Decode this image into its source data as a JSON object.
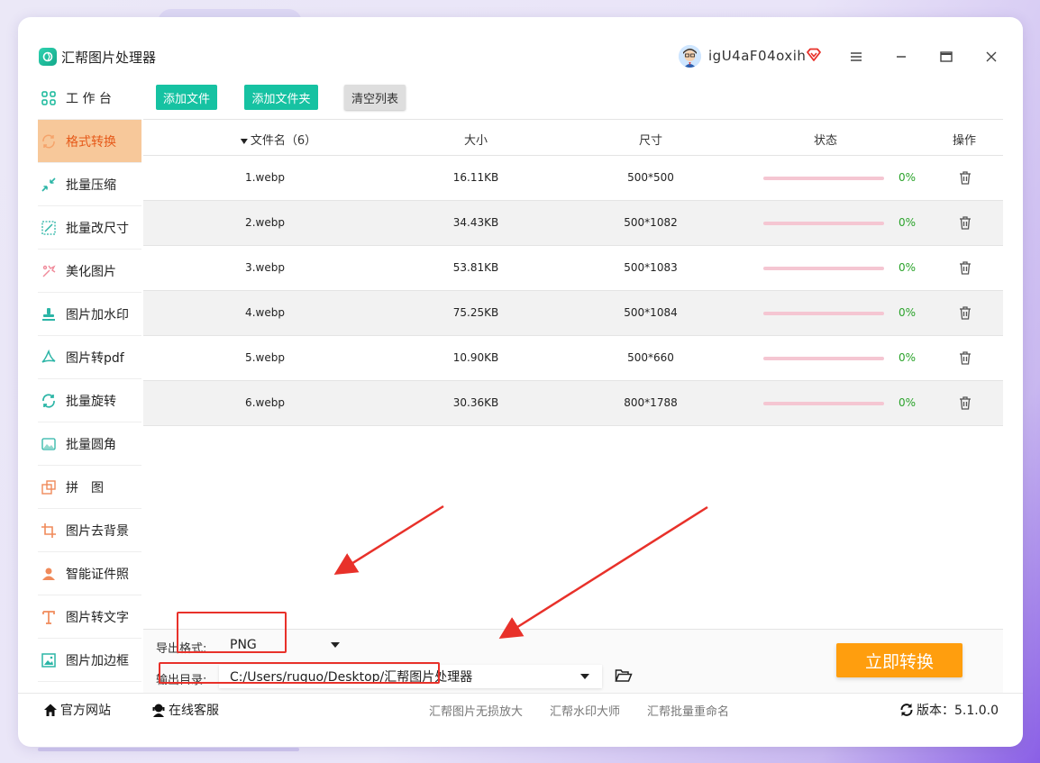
{
  "app": {
    "title": "汇帮图片处理器",
    "username": "igU4aF04oxih"
  },
  "sidebar": {
    "items": [
      {
        "label": "工 作 台",
        "icon": "grid-icon",
        "active": false
      },
      {
        "label": "格式转换",
        "icon": "convert-icon",
        "active": true
      },
      {
        "label": "批量压缩",
        "icon": "compress-icon",
        "active": false
      },
      {
        "label": "批量改尺寸",
        "icon": "resize-icon",
        "active": false
      },
      {
        "label": "美化图片",
        "icon": "beautify-icon",
        "active": false
      },
      {
        "label": "图片加水印",
        "icon": "watermark-icon",
        "active": false
      },
      {
        "label": "图片转pdf",
        "icon": "pdf-icon",
        "active": false
      },
      {
        "label": "批量旋转",
        "icon": "rotate-icon",
        "active": false
      },
      {
        "label": "批量圆角",
        "icon": "round-corner-icon",
        "active": false
      },
      {
        "label": "拼　图",
        "icon": "collage-icon",
        "active": false
      },
      {
        "label": "图片去背景",
        "icon": "crop-icon",
        "active": false
      },
      {
        "label": "智能证件照",
        "icon": "person-icon",
        "active": false
      },
      {
        "label": "图片转文字",
        "icon": "text-icon",
        "active": false
      },
      {
        "label": "图片加边框",
        "icon": "frame-icon",
        "active": false
      }
    ]
  },
  "toolbar": {
    "add_file": "添加文件",
    "add_folder": "添加文件夹",
    "clear_list": "清空列表"
  },
  "table": {
    "headers": {
      "name": "文件名（6）",
      "size": "大小",
      "dimensions": "尺寸",
      "status": "状态",
      "action": "操作"
    },
    "rows": [
      {
        "name": "1.webp",
        "size": "16.11KB",
        "dimensions": "500*500",
        "progress": "0%"
      },
      {
        "name": "2.webp",
        "size": "34.43KB",
        "dimensions": "500*1082",
        "progress": "0%"
      },
      {
        "name": "3.webp",
        "size": "53.81KB",
        "dimensions": "500*1083",
        "progress": "0%"
      },
      {
        "name": "4.webp",
        "size": "75.25KB",
        "dimensions": "500*1084",
        "progress": "0%"
      },
      {
        "name": "5.webp",
        "size": "10.90KB",
        "dimensions": "500*660",
        "progress": "0%"
      },
      {
        "name": "6.webp",
        "size": "30.36KB",
        "dimensions": "800*1788",
        "progress": "0%"
      }
    ]
  },
  "output": {
    "format_label": "导出格式:",
    "format_value": "PNG",
    "dir_label": "输出目录:",
    "dir_value": "C:/Users/ruguo/Desktop/汇帮图片处理器",
    "convert_button": "立即转换"
  },
  "footer": {
    "website": "官方网站",
    "support": "在线客服",
    "links": [
      "汇帮图片无损放大",
      "汇帮水印大师",
      "汇帮批量重命名"
    ],
    "version": "版本：5.1.0.0"
  },
  "colors": {
    "accent_teal": "#16c2a2",
    "accent_orange": "#ff9e0e",
    "active_nav": "#f7c89a",
    "annotation_red": "#e8312a"
  }
}
